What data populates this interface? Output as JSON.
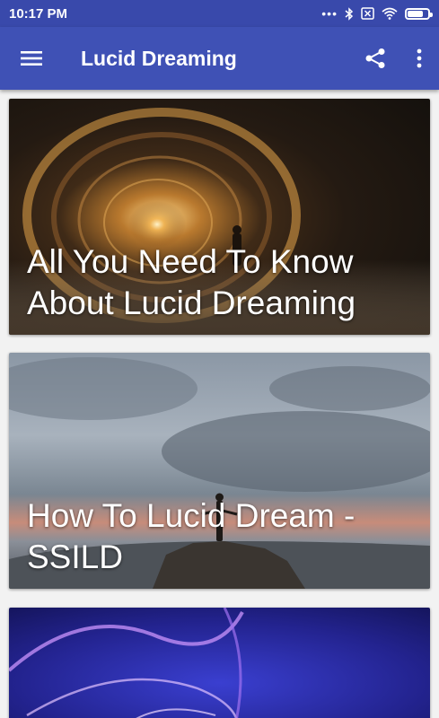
{
  "status_bar": {
    "time": "10:17 PM",
    "icons": [
      "more-dots-icon",
      "bluetooth-icon",
      "sim-blocked-icon",
      "wifi-icon",
      "battery-icon"
    ],
    "battery_level": 0.75
  },
  "app_bar": {
    "title": "Lucid Dreaming",
    "menu_icon": "hamburger-menu-icon",
    "share_icon": "share-icon",
    "overflow_icon": "overflow-menu-icon",
    "color": "#3f51b5",
    "status_color": "#3949ab"
  },
  "cards": [
    {
      "title": "All You Need To Know About Lucid Dreaming",
      "image": "glowing-tunnel-silhouette"
    },
    {
      "title": "How To Lucid Dream - SSILD",
      "image": "person-on-cliff-cloudy-sky"
    },
    {
      "title": "",
      "image": "plasma-ball-purple"
    }
  ]
}
